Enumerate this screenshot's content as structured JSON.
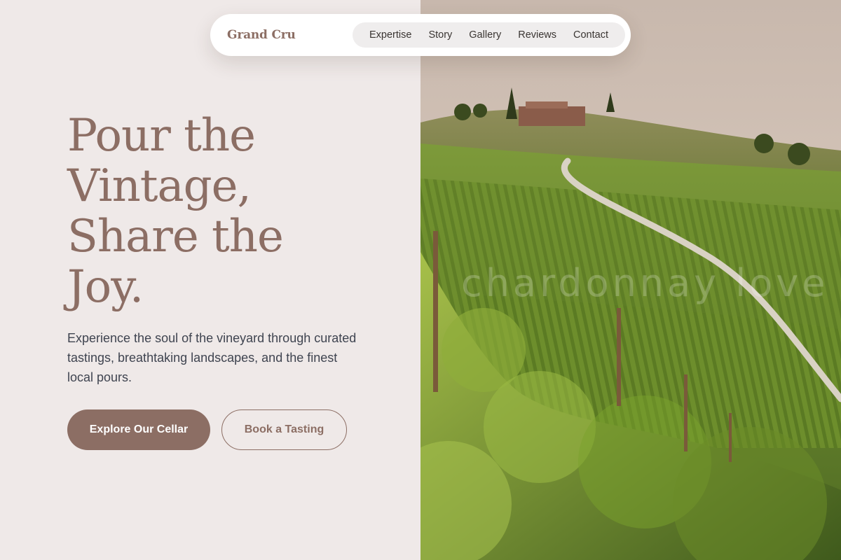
{
  "brand": {
    "name": "Grand Cru"
  },
  "nav": {
    "items": [
      {
        "label": "Expertise"
      },
      {
        "label": "Story"
      },
      {
        "label": "Gallery"
      },
      {
        "label": "Reviews"
      },
      {
        "label": "Contact"
      }
    ]
  },
  "hero": {
    "title_lines": [
      "Pour the",
      "Vintage,",
      "Share the",
      "Joy."
    ],
    "subtitle": "Experience the soul of the vineyard through curated tastings, breathtaking landscapes, and the finest local pours.",
    "primary_cta": "Explore Our Cellar",
    "secondary_cta": "Book a Tasting",
    "image_watermark": "chardonnay love"
  },
  "colors": {
    "accent": "#8c6e64",
    "background": "#efe9e8",
    "text": "#3f4450"
  },
  "icons": [
    "vineyard-photo"
  ]
}
